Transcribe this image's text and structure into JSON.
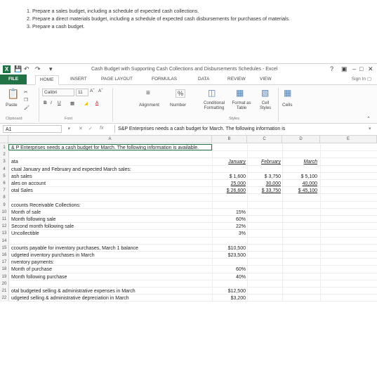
{
  "instructions": [
    "1. Prepare a sales budget, including a schedule of expected cash collections.",
    "2. Prepare a direct materials budget, including a schedule of expected cash disbursements for purchases of materials.",
    "3. Prepare a cash budget."
  ],
  "window": {
    "title": "Cash Budget with Supporting Cash Collections and Disbursements Schedules - Excel",
    "help": "?",
    "minimize": "–",
    "restore": "□",
    "close": "✕",
    "sign_in": "Sign In"
  },
  "tabs": [
    "FILE",
    "HOME",
    "INSERT",
    "PAGE LAYOUT",
    "FORMULAS",
    "DATA",
    "REVIEW",
    "VIEW"
  ],
  "ribbon": {
    "paste": "Paste",
    "font_name": "Calibri",
    "font_size": "11",
    "bold": "B",
    "italic": "I",
    "underline": "U",
    "alignment": "Alignment",
    "number": "Number",
    "conditional_formatting": "Conditional Formatting",
    "format_as_table": "Format as Table",
    "cell_styles": "Cell Styles",
    "cells": "Cells",
    "groups": [
      "Clipboard",
      "Font",
      "Styles"
    ]
  },
  "formula_bar": {
    "name_box": "A1",
    "fx": "fx",
    "content": "S&P Enterprises needs a cash budget for March. The following information is"
  },
  "columns": [
    "A",
    "B",
    "C",
    "D",
    "E"
  ],
  "rows": [
    {
      "n": "1",
      "a": "& P Enterprises needs a cash budget for March. The following information is available.",
      "b": "",
      "c": "",
      "d": ""
    },
    {
      "n": "2",
      "a": "",
      "b": "",
      "c": "",
      "d": ""
    },
    {
      "n": "3",
      "a": "ata",
      "b": "January",
      "c": "February",
      "d": "March"
    },
    {
      "n": "4",
      "a": "ctual January and February and expected March sales:",
      "b": "",
      "c": "",
      "d": ""
    },
    {
      "n": "5",
      "a": "ash sales",
      "b": "$     1,600",
      "c": "$     3,750",
      "d": "$     5,100"
    },
    {
      "n": "6",
      "a": "ales on account",
      "b": "25,000",
      "c": "30,000",
      "d": "40,000"
    },
    {
      "n": "7",
      "a": "otal Sales",
      "b": "$   26,600",
      "c": "$   33,750",
      "d": "$   45,100"
    },
    {
      "n": "8",
      "a": "",
      "b": "",
      "c": "",
      "d": ""
    },
    {
      "n": "9",
      "a": "ccounts Receivable Collections:",
      "b": "",
      "c": "",
      "d": ""
    },
    {
      "n": "10",
      "a": "Month of sale",
      "b": "15%",
      "c": "",
      "d": ""
    },
    {
      "n": "11",
      "a": "Month following sale",
      "b": "60%",
      "c": "",
      "d": ""
    },
    {
      "n": "12",
      "a": "Second month following sale",
      "b": "22%",
      "c": "",
      "d": ""
    },
    {
      "n": "13",
      "a": "Uncollectible",
      "b": "3%",
      "c": "",
      "d": ""
    },
    {
      "n": "14",
      "a": "",
      "b": "",
      "c": "",
      "d": ""
    },
    {
      "n": "15",
      "a": "ccounts payable for inventory purchases, March 1 balance",
      "b": "$10,500",
      "c": "",
      "d": ""
    },
    {
      "n": "16",
      "a": "udgeted inventory purchases in March",
      "b": "$23,500",
      "c": "",
      "d": ""
    },
    {
      "n": "17",
      "a": "nventory payments:",
      "b": "",
      "c": "",
      "d": ""
    },
    {
      "n": "18",
      "a": "Month of purchase",
      "b": "60%",
      "c": "",
      "d": ""
    },
    {
      "n": "19",
      "a": "Month following purchase",
      "b": "40%",
      "c": "",
      "d": ""
    },
    {
      "n": "20",
      "a": "",
      "b": "",
      "c": "",
      "d": ""
    },
    {
      "n": "21",
      "a": "otal budgeted selling & administrative expenses in March",
      "b": "$12,500",
      "c": "",
      "d": ""
    },
    {
      "n": "22",
      "a": "udgeted selling & administrative depreciation in March",
      "b": "$3,200",
      "c": "",
      "d": ""
    }
  ]
}
